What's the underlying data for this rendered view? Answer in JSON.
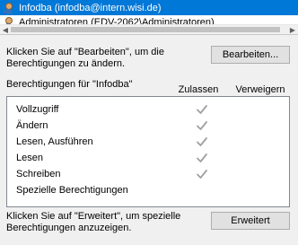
{
  "users": {
    "selected": "Infodba (infodba@intern.wisi.de)",
    "next": "Administratoren (EDV-2062\\Administratoren)"
  },
  "edit_hint": "Klicken Sie auf \"Bearbeiten\", um die\nBerechtigungen zu ändern.",
  "edit_button": "Bearbeiten...",
  "permissions_title": "Berechtigungen für \"Infodba\"",
  "columns": {
    "allow": "Zulassen",
    "deny": "Verweigern"
  },
  "permissions": [
    {
      "name": "Vollzugriff",
      "allow": true,
      "deny": false
    },
    {
      "name": "Ändern",
      "allow": true,
      "deny": false
    },
    {
      "name": "Lesen, Ausführen",
      "allow": true,
      "deny": false
    },
    {
      "name": "Lesen",
      "allow": true,
      "deny": false
    },
    {
      "name": "Schreiben",
      "allow": true,
      "deny": false
    },
    {
      "name": "Spezielle Berechtigungen",
      "allow": false,
      "deny": false
    }
  ],
  "advanced_hint": "Klicken Sie auf \"Erweitert\", um spezielle\nBerechtigungen anzuzeigen.",
  "advanced_button": "Erweitert",
  "colors": {
    "selection": "#0078d7",
    "check": "#a0a0a0"
  }
}
